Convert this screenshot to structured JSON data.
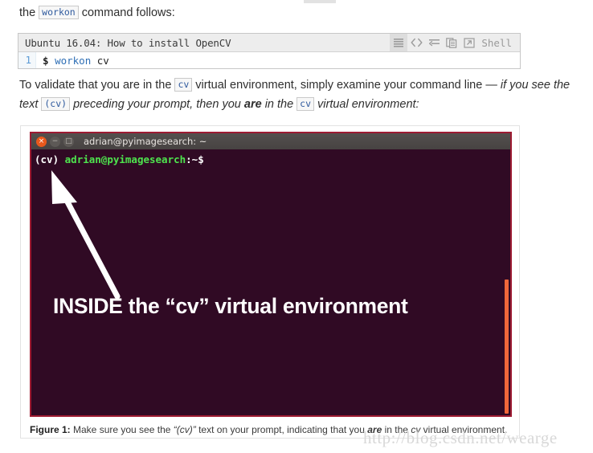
{
  "intro": {
    "before": "the",
    "code": "workon",
    "after": "command follows:"
  },
  "codeblock": {
    "title": "Ubuntu 16.04: How to install OpenCV",
    "tools": [
      {
        "name": "toggle-line-numbers-icon",
        "label": ""
      },
      {
        "name": "view-source-icon",
        "label": ""
      },
      {
        "name": "toggle-word-wrap-icon",
        "label": ""
      },
      {
        "name": "copy-to-clipboard-icon",
        "label": ""
      },
      {
        "name": "open-in-new-window-icon",
        "label": ""
      }
    ],
    "language_label": "Shell",
    "lines": [
      {
        "number": "1",
        "prompt": "$",
        "command": "workon",
        "argument": "cv"
      }
    ]
  },
  "validate_paragraph": {
    "s1": "To validate that you are in the",
    "c1": "cv",
    "s2": "virtual environment, simply examine your command line —",
    "s3": "if you see the text",
    "c2": "(cv)",
    "s4": "preceding your prompt, then you",
    "s5": "are",
    "s6": "in the",
    "c3": "cv",
    "s7": "virtual environment:"
  },
  "figure": {
    "terminal": {
      "window_title": "adrian@pyimagesearch: ~",
      "buttons": {
        "close": "×",
        "minimize": "−",
        "maximize": "□"
      },
      "prompt": {
        "venv": "(cv)",
        "user_host": "adrian@pyimagesearch",
        "path": ":~$"
      },
      "annotation": "INSIDE the “cv” virtual environment"
    },
    "caption": {
      "label": "Figure 1:",
      "t1": "Make sure you see the",
      "t2": "“(cv)”",
      "t3": "text on your prompt, indicating that you",
      "t4": "are",
      "t5": "in the",
      "t6": "cv",
      "t7": "virtual environment."
    }
  },
  "watermark": {
    "text": "http://blog.csdn.net/wearge"
  },
  "colors": {
    "terminal_bg": "#300a24",
    "terminal_border": "#9e1b32",
    "prompt_green": "#4ee44e",
    "scrollbar": "#f0673a",
    "code_keyword": "#2f6fb5",
    "close_button": "#e8581c"
  }
}
